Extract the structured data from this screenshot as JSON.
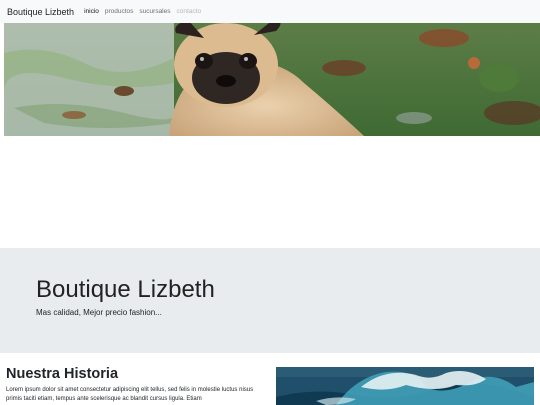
{
  "navbar": {
    "brand": "Boutique Lizbeth",
    "links": [
      {
        "label": "inicio",
        "state": "active"
      },
      {
        "label": "productos",
        "state": "normal"
      },
      {
        "label": "sucursales",
        "state": "normal"
      },
      {
        "label": "contacto",
        "state": "disabled"
      }
    ]
  },
  "hero": {
    "image": "pug-on-frosted-grass"
  },
  "jumbotron": {
    "title": "Boutique Lizbeth",
    "subtitle": "Mas calidad, Mejor precio fashion..."
  },
  "historia": {
    "title": "Nuestra Historia",
    "text": "Lorem ipsum dolor sit amet consectetur adipiscing elit tellus, sed felis in molestie luctus nisus primis taciti etiam, tempus ante scelerisque ac blandit cursus ligula. Etiam",
    "image": "ocean-wave"
  },
  "colors": {
    "navbar_bg": "#f8f9fa",
    "jumbotron_bg": "#e9ecef",
    "text": "#212529"
  }
}
